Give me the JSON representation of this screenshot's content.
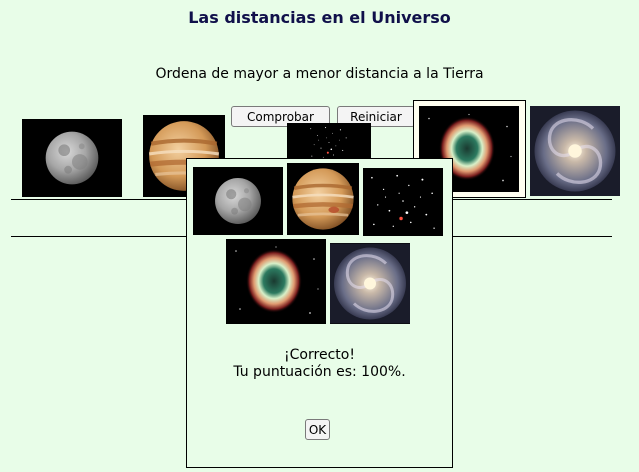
{
  "page": {
    "title": "Las distancias en el Universo",
    "instruction": "Ordena de mayor a menor distancia a la Tierra"
  },
  "controls": {
    "check_label": "Comprobar",
    "reset_label": "Reiniciar"
  },
  "images": [
    {
      "name": "moon-image",
      "depicts": "Moon"
    },
    {
      "name": "jupiter-image",
      "depicts": "Jupiter"
    },
    {
      "name": "star-field-image",
      "depicts": "Star field"
    },
    {
      "name": "ring-nebula-image",
      "depicts": "Ring nebula"
    },
    {
      "name": "spiral-galaxy-image",
      "depicts": "Spiral galaxy"
    }
  ],
  "dialog": {
    "message_line1": "¡Correcto!",
    "message_line2": "Tu puntuación es: 100%.",
    "ok_label": "OK"
  },
  "colors": {
    "background": "#e8fde8",
    "title_color": "#10104a"
  }
}
